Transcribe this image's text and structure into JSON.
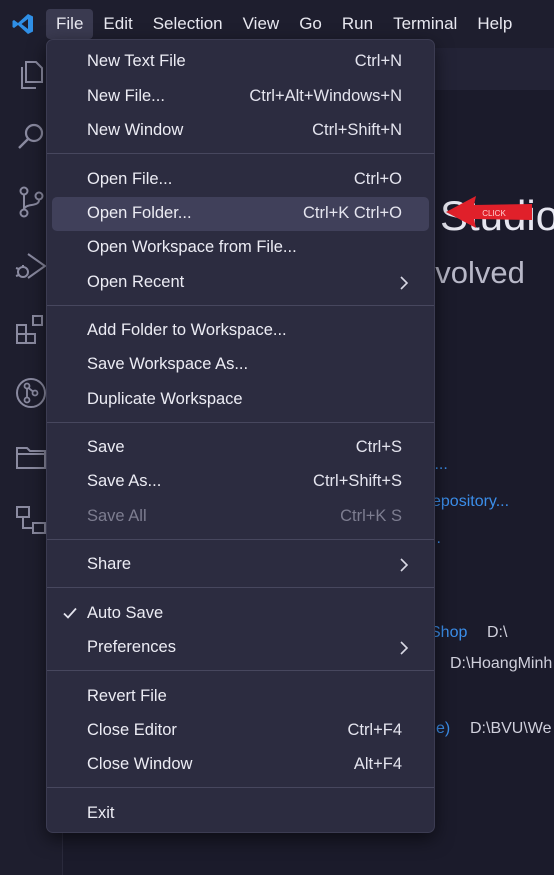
{
  "menubar": {
    "logo_icon": "vscode-logo-icon",
    "items": [
      "File",
      "Edit",
      "Selection",
      "View",
      "Go",
      "Run",
      "Terminal",
      "Help"
    ]
  },
  "activitybar": {
    "icons": [
      "files-icon",
      "search-icon",
      "source-control-icon",
      "run-debug-icon",
      "extensions-icon",
      "remote-icon",
      "folder-icon",
      "remote-explorer-icon"
    ]
  },
  "welcome": {
    "title": "Studio",
    "subtitle": "evolved",
    "link_1": "r...",
    "link_2": "epository...",
    "link_3": "..",
    "recent_1_name": "Shop",
    "recent_1_path": "D:\\",
    "recent_2_path": "D:\\HoangMinh",
    "recent_3_name": "e)",
    "recent_3_path": "D:\\BVU\\We",
    "arrow_text": "CLICK"
  },
  "file_menu": {
    "new_text_file": {
      "label": "New Text File",
      "shortcut": "Ctrl+N"
    },
    "new_file": {
      "label": "New File...",
      "shortcut": "Ctrl+Alt+Windows+N"
    },
    "new_window": {
      "label": "New Window",
      "shortcut": "Ctrl+Shift+N"
    },
    "open_file": {
      "label": "Open File...",
      "shortcut": "Ctrl+O"
    },
    "open_folder": {
      "label": "Open Folder...",
      "shortcut": "Ctrl+K Ctrl+O"
    },
    "open_workspace": {
      "label": "Open Workspace from File..."
    },
    "open_recent": {
      "label": "Open Recent"
    },
    "add_folder": {
      "label": "Add Folder to Workspace..."
    },
    "save_workspace_as": {
      "label": "Save Workspace As..."
    },
    "duplicate_workspace": {
      "label": "Duplicate Workspace"
    },
    "save": {
      "label": "Save",
      "shortcut": "Ctrl+S"
    },
    "save_as": {
      "label": "Save As...",
      "shortcut": "Ctrl+Shift+S"
    },
    "save_all": {
      "label": "Save All",
      "shortcut": "Ctrl+K S"
    },
    "share": {
      "label": "Share"
    },
    "auto_save": {
      "label": "Auto Save",
      "checked": true
    },
    "preferences": {
      "label": "Preferences"
    },
    "revert_file": {
      "label": "Revert File"
    },
    "close_editor": {
      "label": "Close Editor",
      "shortcut": "Ctrl+F4"
    },
    "close_window": {
      "label": "Close Window",
      "shortcut": "Alt+F4"
    },
    "exit": {
      "label": "Exit"
    }
  },
  "colors": {
    "accent_blue": "#3b8eea",
    "menu_bg": "#2c2c40",
    "highlight": "#40405a",
    "arrow_red": "#e0202a"
  }
}
